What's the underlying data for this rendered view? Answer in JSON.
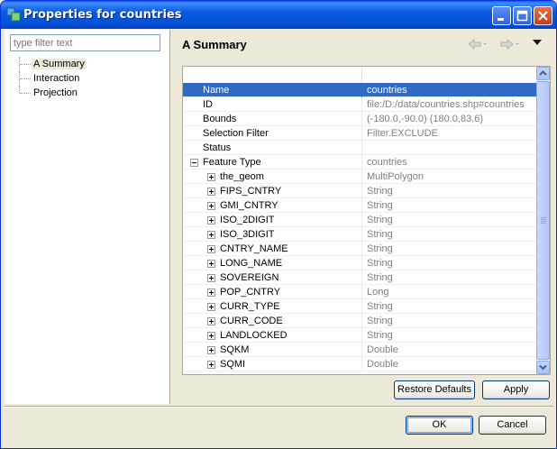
{
  "window": {
    "title": "Properties for countries"
  },
  "filter": {
    "placeholder": "type filter text",
    "value": ""
  },
  "nav_items": [
    {
      "label": "A Summary",
      "selected": true
    },
    {
      "label": "Interaction",
      "selected": false
    },
    {
      "label": "Projection",
      "selected": false
    }
  ],
  "page": {
    "title": "A Summary"
  },
  "table": {
    "rows": [
      {
        "name": "Name",
        "value": "countries",
        "indent": 0,
        "expander": "none",
        "selected": true
      },
      {
        "name": "ID",
        "value": "file:/D:/data/countries.shp#countries",
        "indent": 0,
        "expander": "none"
      },
      {
        "name": "Bounds",
        "value": "(-180.0,-90.0) (180.0,83.6)",
        "indent": 0,
        "expander": "none"
      },
      {
        "name": "Selection Filter",
        "value": "Filter.EXCLUDE",
        "indent": 0,
        "expander": "none"
      },
      {
        "name": "Status",
        "value": "",
        "indent": 0,
        "expander": "none"
      },
      {
        "name": "Feature Type",
        "value": "countries",
        "indent": 0,
        "expander": "collapse"
      },
      {
        "name": "the_geom",
        "value": "MultiPolygon",
        "indent": 1,
        "expander": "expand"
      },
      {
        "name": "FIPS_CNTRY",
        "value": "String",
        "indent": 1,
        "expander": "expand"
      },
      {
        "name": "GMI_CNTRY",
        "value": "String",
        "indent": 1,
        "expander": "expand"
      },
      {
        "name": "ISO_2DIGIT",
        "value": "String",
        "indent": 1,
        "expander": "expand"
      },
      {
        "name": "ISO_3DIGIT",
        "value": "String",
        "indent": 1,
        "expander": "expand"
      },
      {
        "name": "CNTRY_NAME",
        "value": "String",
        "indent": 1,
        "expander": "expand"
      },
      {
        "name": "LONG_NAME",
        "value": "String",
        "indent": 1,
        "expander": "expand"
      },
      {
        "name": "SOVEREIGN",
        "value": "String",
        "indent": 1,
        "expander": "expand"
      },
      {
        "name": "POP_CNTRY",
        "value": "Long",
        "indent": 1,
        "expander": "expand"
      },
      {
        "name": "CURR_TYPE",
        "value": "String",
        "indent": 1,
        "expander": "expand"
      },
      {
        "name": "CURR_CODE",
        "value": "String",
        "indent": 1,
        "expander": "expand"
      },
      {
        "name": "LANDLOCKED",
        "value": "String",
        "indent": 1,
        "expander": "expand"
      },
      {
        "name": "SQKM",
        "value": "Double",
        "indent": 1,
        "expander": "expand"
      },
      {
        "name": "SQMI",
        "value": "Double",
        "indent": 1,
        "expander": "expand"
      }
    ]
  },
  "buttons": {
    "restore_defaults": "Restore Defaults",
    "apply": "Apply",
    "ok": "OK",
    "cancel": "Cancel"
  },
  "colors": {
    "selection": "#316AC5",
    "title_bar": "#0A5AE0"
  }
}
